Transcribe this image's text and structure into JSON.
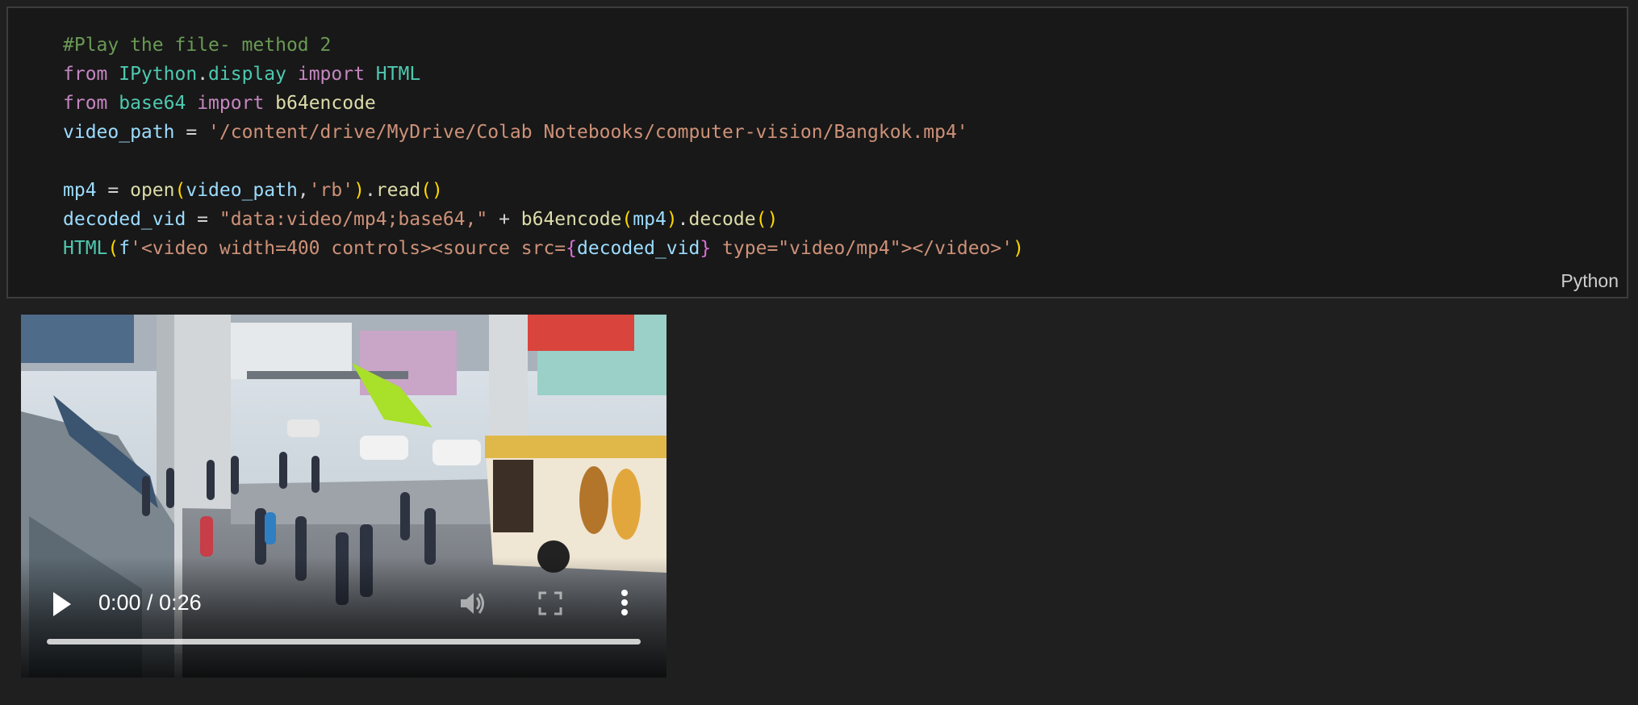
{
  "cell": {
    "language_label": "Python",
    "code": {
      "line1": {
        "comment": "#Play the file- method 2"
      },
      "line2": {
        "kw1": "from",
        "module_a": "IPython",
        "dot": ".",
        "module_b": "display",
        "kw2": "import",
        "name": "HTML"
      },
      "line3": {
        "kw1": "from",
        "module": "base64",
        "kw2": "import",
        "name": "b64encode"
      },
      "line4": {
        "var": "video_path",
        "op": " = ",
        "value": "'/content/drive/MyDrive/Colab Notebooks/computer-vision/Bangkok.mp4'"
      },
      "line6": {
        "var": "mp4",
        "op": " = ",
        "fn": "open",
        "lp": "(",
        "arg": "video_path",
        "comma": ",",
        "mode": "'rb'",
        "rp": ")",
        "dot": ".",
        "method": "read",
        "call": "()"
      },
      "line7": {
        "var": "decoded_vid",
        "op": " = ",
        "str": "\"data:video/mp4;base64,\"",
        "plus": " + ",
        "fn": "b64encode",
        "lp": "(",
        "arg": "mp4",
        "rp": ")",
        "dot": ".",
        "method": "decode",
        "call": "()"
      },
      "line8": {
        "fn": "HTML",
        "lp": "(",
        "prefix": "f",
        "str_a": "'<video width=400 controls><source src=",
        "lbrace": "{",
        "expr": "decoded_vid",
        "rbrace": "}",
        "str_b": " type=\"video/mp4\"></video>'",
        "rp": ")"
      }
    }
  },
  "video": {
    "time_display": "0:00 / 0:26",
    "progress": 0,
    "controls": [
      "play",
      "volume",
      "fullscreen",
      "more-options"
    ]
  }
}
